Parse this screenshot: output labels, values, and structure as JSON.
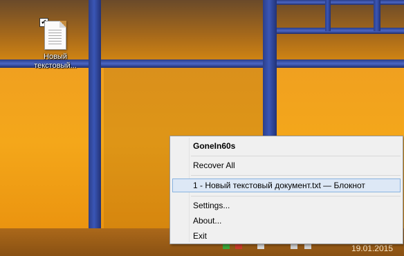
{
  "desktop": {
    "icon": {
      "name": "text-file-icon",
      "label_line1": "Новый",
      "label_line2": "текстовый...",
      "selected_checkbox": "✔"
    }
  },
  "context_menu": {
    "title": "GoneIn60s",
    "items": [
      {
        "label": "Recover All"
      },
      {
        "label": "1 - Новый текстовый документ.txt — Блокнот",
        "highlighted": true
      },
      {
        "label": "Settings..."
      },
      {
        "label": "About..."
      },
      {
        "label": "Exit"
      }
    ]
  },
  "taskbar": {
    "clock_date": "19.01.2015"
  },
  "colors": {
    "menu_background": "#f0f0f0",
    "highlight": "#dde8f6",
    "highlight_border": "#88b3e0",
    "wallpaper_orange": "#f4a71a",
    "window_frame_blue": "#3a56b6"
  }
}
